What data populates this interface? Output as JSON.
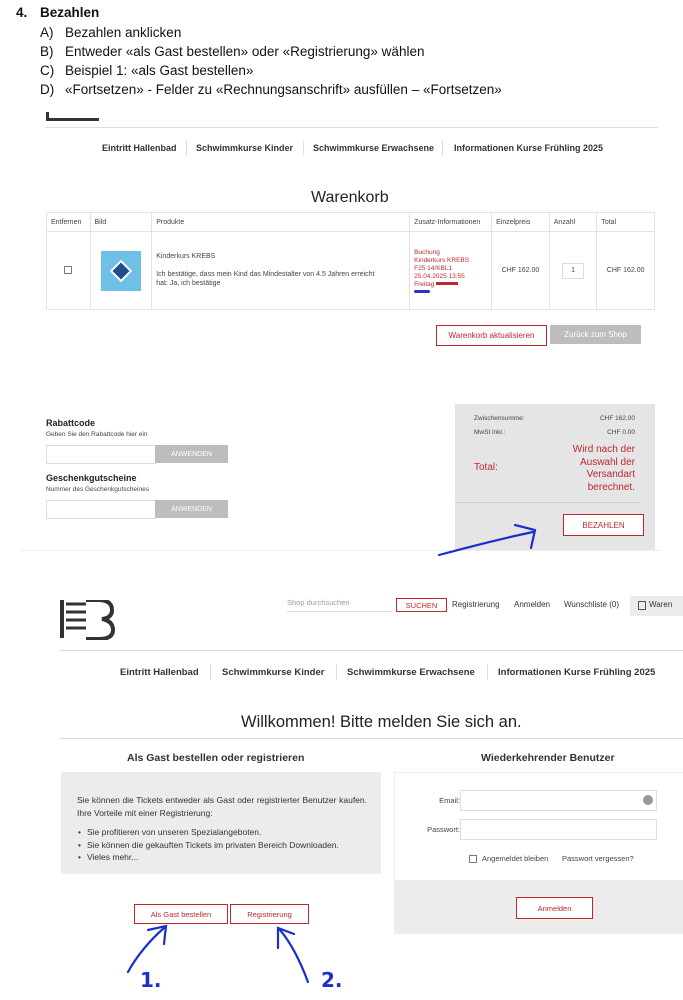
{
  "instructions": {
    "heading_number": "4.",
    "heading": "Bezahlen",
    "steps": [
      {
        "letter": "A)",
        "text": "Bezahlen anklicken"
      },
      {
        "letter": "B)",
        "text": "Entweder «als Gast bestellen» oder «Registrierung» wählen"
      },
      {
        "letter": "C)",
        "text": "Beispiel 1: «als Gast bestellen»"
      },
      {
        "letter": "D)",
        "text": "«Fortsetzen» - Felder zu «Rechnungsanschrift» ausfüllen – «Fortsetzen»"
      }
    ]
  },
  "shot1": {
    "nav": [
      "Eintritt Hallenbad",
      "Schwimmkurse Kinder",
      "Schwimmkurse Erwachsene",
      "Informationen Kurse Frühling 2025"
    ],
    "title": "Warenkorb",
    "table_headers": [
      "Entfernen",
      "Bild",
      "Produkte",
      "Zusatz-Informationen",
      "Einzelpreis",
      "Anzahl",
      "Total"
    ],
    "row": {
      "product_name": "Kinderkurs KREBS",
      "product_desc": "Ich bestätige, dass mein Kind das Mindestalter von 4.5 Jahren erreicht hat: Ja, ich bestätige",
      "info_lines": [
        "Buchung",
        "Kinderkurs KREBS",
        "F25 14/KBL1",
        "25.04.2025 13:55",
        "Freitag"
      ],
      "price": "CHF 162.00",
      "qty": "1",
      "total": "CHF 162.00"
    },
    "update_cart": "Warenkorb aktualisieren",
    "back_to_shop": "Zurück zum Shop",
    "discount_title": "Rabattcode",
    "discount_hint": "Geben Sie den Rabattcode hier ein",
    "apply": "ANWENDEN",
    "gift_title": "Geschenkgutscheine",
    "gift_hint": "Nummer des Geschenkgutscheines",
    "apply2": "ANWENDEN",
    "subtotal_label": "Zwischensumme:",
    "subtotal_value": "CHF 162.00",
    "vat_label": "MwSt inkl.:",
    "vat_value": "CHF 0.00",
    "total_label": "Total:",
    "total_note": "Wird nach der Auswahl der Versandart berechnet.",
    "pay": "BEZAHLEN"
  },
  "shot2": {
    "search_placeholder": "Shop durchsuchen",
    "search_btn": "SUCHEN",
    "top_links": [
      "Registrierung",
      "Anmelden",
      "Wunschliste (0)"
    ],
    "cart_link": "Waren",
    "nav": [
      "Eintritt Hallenbad",
      "Schwimmkurse Kinder",
      "Schwimmkurse Erwachsene",
      "Informationen Kurse Frühling 2025"
    ],
    "title": "Willkommen! Bitte melden Sie sich an.",
    "guest_title": "Als Gast bestellen oder registrieren",
    "returning_title": "Wiederkehrender Benutzer",
    "guest_text": "Sie können die Tickets entweder als Gast oder registrierter Benutzer kaufen. Ihre Vorteile mit einer Registrierung:",
    "bullets": [
      "Sie profitieren von unseren Spezialangeboten.",
      "Sie können die gekauften Tickets im privaten Bereich Downloaden.",
      "Vieles mehr..."
    ],
    "guest_btn": "Als Gast bestellen",
    "register_btn": "Registrierung",
    "email_label": "Email:",
    "password_label": "Passwort:",
    "remember": "Angemeldet bleiben",
    "forgot": "Passwort vergessen?",
    "login_btn": "Anmelden"
  },
  "annotations": {
    "arrow1_label": "1.",
    "arrow2_label": "2."
  }
}
